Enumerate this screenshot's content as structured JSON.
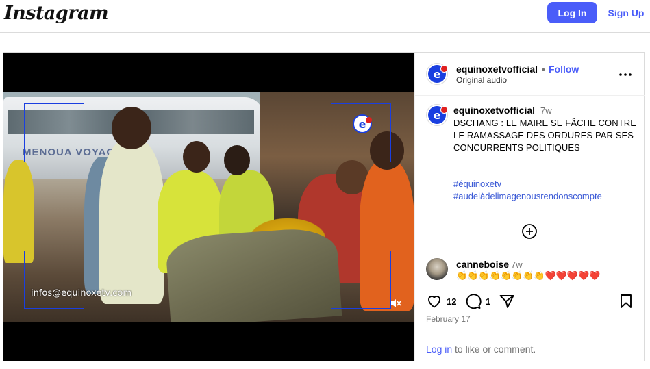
{
  "header": {
    "logo_text": "Instagram",
    "login_label": "Log In",
    "signup_label": "Sign Up"
  },
  "video": {
    "watermark_email": "infos@equinoxetv.com",
    "bus_text": "MENOUA VOYAGE",
    "channel_logo_letter": "e",
    "muted": true
  },
  "post_header": {
    "username": "equinoxetvofficial",
    "separator": "•",
    "follow_label": "Follow",
    "audio_label": "Original audio"
  },
  "caption": {
    "username": "equinoxetvofficial",
    "time": "7w",
    "text": "DSCHANG : LE MAIRE SE FÂCHE CONTRE LE RAMASSAGE DES ORDURES PAR SES CONCURRENTS POLITIQUES",
    "hashtags": [
      "#équinoxetv",
      "#audelàdelimagenousrendonscompte"
    ]
  },
  "comments": [
    {
      "username": "canneboise",
      "time": "7w",
      "text": "👏👏👏👏👏👏👏👏❤️❤️❤️❤️❤️"
    }
  ],
  "actions": {
    "likes_count": "12",
    "comments_count": "1",
    "date": "February 17"
  },
  "login_prompt": {
    "link_label": "Log in",
    "rest": "to like or comment."
  },
  "colors": {
    "accent": "#4a5df9",
    "hashtag": "#3b5ad6",
    "brand_blue": "#1a3fe0"
  }
}
